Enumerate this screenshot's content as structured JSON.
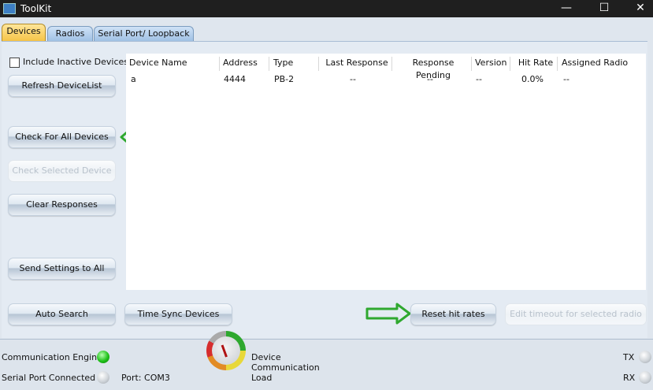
{
  "window": {
    "title": "ToolKit"
  },
  "tabs": [
    "Devices",
    "Radios",
    "Serial Port/ Loopback"
  ],
  "options": {
    "include_inactive_label": "Include Inactive Devices",
    "include_inactive_checked": false
  },
  "buttons": {
    "refresh": "Refresh DeviceList",
    "check_all": "Check For All Devices",
    "check_selected": "Check Selected Device",
    "clear_responses": "Clear Responses",
    "send_settings": "Send Settings to All",
    "auto_search": "Auto Search",
    "time_sync": "Time Sync Devices",
    "reset_hit_rates": "Reset hit rates",
    "edit_timeout": "Edit timeout for selected radio"
  },
  "device_table": {
    "columns": [
      "Device Name",
      "Address",
      "Type",
      "Last Response",
      "Response Pending",
      "Version",
      "Hit Rate",
      "Assigned Radio"
    ],
    "rows": [
      [
        "a",
        "4444",
        "PB-2",
        "--",
        "--",
        "--",
        "0.0%",
        "--"
      ]
    ]
  },
  "status": {
    "comm_engine_label": "Communication Engine",
    "serial_port_label": "Serial Port Connected",
    "port_label": "Port: COM3",
    "load_label_1": "Device",
    "load_label_2": "Communication",
    "load_label_3": "Load",
    "tx_label": "TX",
    "rx_label": "RX",
    "comm_engine_status_color": "#1fc21a",
    "serial_port_status_color": "#cfd4d9"
  }
}
